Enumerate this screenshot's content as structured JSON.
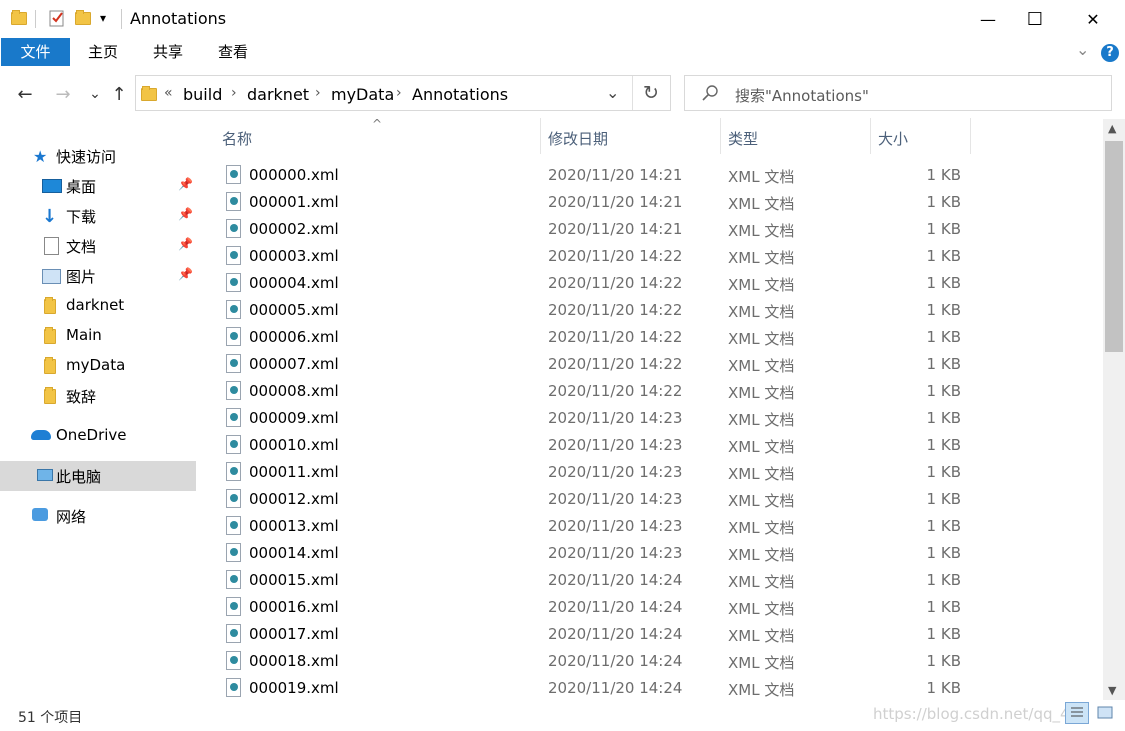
{
  "window": {
    "title": "Annotations",
    "qat_dropdown": "▾",
    "minimize": "—",
    "maximize": "☐",
    "close": "✕"
  },
  "ribbon": {
    "tabs": [
      "文件",
      "主页",
      "共享",
      "查看"
    ],
    "collapse": "⌄",
    "help": "?"
  },
  "nav": {
    "back": "←",
    "forward": "→",
    "recent": "⌄",
    "up": "↑"
  },
  "address": {
    "overflow": "«",
    "crumbs": [
      "build",
      "darknet",
      "myData",
      "Annotations"
    ],
    "separator": "›",
    "dropdown": "⌄",
    "refresh": "↻"
  },
  "search": {
    "placeholder": "搜索\"Annotations\""
  },
  "sidebar": {
    "quick_access": "快速访问",
    "items": [
      {
        "label": "桌面",
        "icon": "desktop-icon",
        "pinned": true
      },
      {
        "label": "下载",
        "icon": "download-icon",
        "pinned": true
      },
      {
        "label": "文档",
        "icon": "document-icon",
        "pinned": true
      },
      {
        "label": "图片",
        "icon": "pictures-icon",
        "pinned": true
      },
      {
        "label": "darknet",
        "icon": "folder-icon",
        "pinned": false
      },
      {
        "label": "Main",
        "icon": "folder-icon",
        "pinned": false
      },
      {
        "label": "myData",
        "icon": "folder-icon",
        "pinned": false
      },
      {
        "label": "致辞",
        "icon": "folder-icon",
        "pinned": false
      }
    ],
    "onedrive": "OneDrive",
    "this_pc": "此电脑",
    "network": "网络",
    "pin_glyph": "📌"
  },
  "columns": {
    "name": "名称",
    "modified": "修改日期",
    "type": "类型",
    "size": "大小",
    "sort_indicator": "^"
  },
  "files": [
    {
      "name": "000000.xml",
      "date": "2020/11/20 14:21",
      "type": "XML 文档",
      "size": "1 KB"
    },
    {
      "name": "000001.xml",
      "date": "2020/11/20 14:21",
      "type": "XML 文档",
      "size": "1 KB"
    },
    {
      "name": "000002.xml",
      "date": "2020/11/20 14:21",
      "type": "XML 文档",
      "size": "1 KB"
    },
    {
      "name": "000003.xml",
      "date": "2020/11/20 14:22",
      "type": "XML 文档",
      "size": "1 KB"
    },
    {
      "name": "000004.xml",
      "date": "2020/11/20 14:22",
      "type": "XML 文档",
      "size": "1 KB"
    },
    {
      "name": "000005.xml",
      "date": "2020/11/20 14:22",
      "type": "XML 文档",
      "size": "1 KB"
    },
    {
      "name": "000006.xml",
      "date": "2020/11/20 14:22",
      "type": "XML 文档",
      "size": "1 KB"
    },
    {
      "name": "000007.xml",
      "date": "2020/11/20 14:22",
      "type": "XML 文档",
      "size": "1 KB"
    },
    {
      "name": "000008.xml",
      "date": "2020/11/20 14:22",
      "type": "XML 文档",
      "size": "1 KB"
    },
    {
      "name": "000009.xml",
      "date": "2020/11/20 14:23",
      "type": "XML 文档",
      "size": "1 KB"
    },
    {
      "name": "000010.xml",
      "date": "2020/11/20 14:23",
      "type": "XML 文档",
      "size": "1 KB"
    },
    {
      "name": "000011.xml",
      "date": "2020/11/20 14:23",
      "type": "XML 文档",
      "size": "1 KB"
    },
    {
      "name": "000012.xml",
      "date": "2020/11/20 14:23",
      "type": "XML 文档",
      "size": "1 KB"
    },
    {
      "name": "000013.xml",
      "date": "2020/11/20 14:23",
      "type": "XML 文档",
      "size": "1 KB"
    },
    {
      "name": "000014.xml",
      "date": "2020/11/20 14:23",
      "type": "XML 文档",
      "size": "1 KB"
    },
    {
      "name": "000015.xml",
      "date": "2020/11/20 14:24",
      "type": "XML 文档",
      "size": "1 KB"
    },
    {
      "name": "000016.xml",
      "date": "2020/11/20 14:24",
      "type": "XML 文档",
      "size": "1 KB"
    },
    {
      "name": "000017.xml",
      "date": "2020/11/20 14:24",
      "type": "XML 文档",
      "size": "1 KB"
    },
    {
      "name": "000018.xml",
      "date": "2020/11/20 14:24",
      "type": "XML 文档",
      "size": "1 KB"
    },
    {
      "name": "000019.xml",
      "date": "2020/11/20 14:24",
      "type": "XML 文档",
      "size": "1 KB"
    }
  ],
  "status": {
    "count": "51 个项目",
    "watermark": "https://blog.csdn.net/qq_4"
  },
  "colors": {
    "accent": "#1979ca",
    "selected_nav": "#d9d9d9",
    "header_text": "#4c607a",
    "folder": "#f2c445"
  }
}
